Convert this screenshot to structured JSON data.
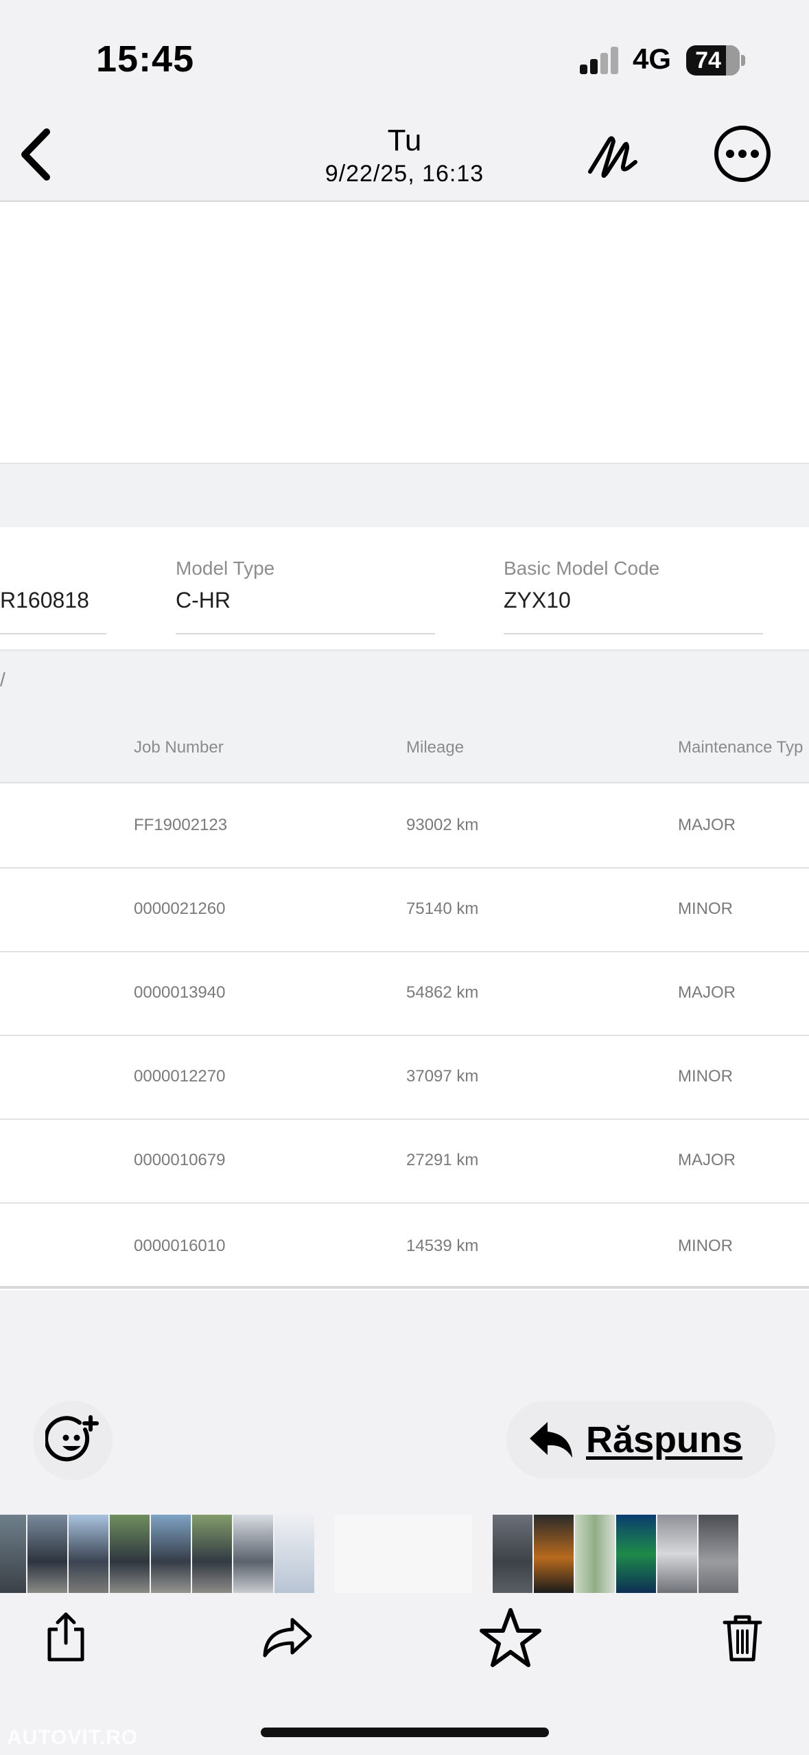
{
  "status_bar": {
    "time": "15:45",
    "network": "4G",
    "battery": "74"
  },
  "header": {
    "sender": "Tu",
    "date": "9/22/25, 16:13"
  },
  "vehicle": {
    "vin_partial": "R160818",
    "model_type_label": "Model Type",
    "model_type": "C-HR",
    "basic_model_code_label": "Basic Model Code",
    "basic_model_code": "ZYX10",
    "section_mark": "/"
  },
  "table": {
    "headers": [
      "Job Number",
      "Mileage",
      "Maintenance Typ"
    ],
    "rows": [
      {
        "job": "FF19002123",
        "mileage": "93002 km",
        "type": "MAJOR"
      },
      {
        "job": "0000021260",
        "mileage": "75140 km",
        "type": "MINOR"
      },
      {
        "job": "0000013940",
        "mileage": "54862 km",
        "type": "MAJOR"
      },
      {
        "job": "0000012270",
        "mileage": "37097 km",
        "type": "MINOR"
      },
      {
        "job": "0000010679",
        "mileage": "27291 km",
        "type": "MAJOR"
      },
      {
        "job": "0000016010",
        "mileage": "14539 km",
        "type": "MINOR"
      }
    ]
  },
  "actions": {
    "reply_label": "Răspuns"
  },
  "icons": {
    "back": "chevron-left-icon",
    "markup": "markup-pen-icon",
    "more": "ellipsis-circle-icon",
    "emoji": "add-reaction-icon",
    "reply": "reply-arrow-icon",
    "share": "share-icon",
    "forward": "forward-icon",
    "favorite": "star-icon",
    "delete": "trash-icon"
  },
  "watermark": "AUTOVIT.RO"
}
